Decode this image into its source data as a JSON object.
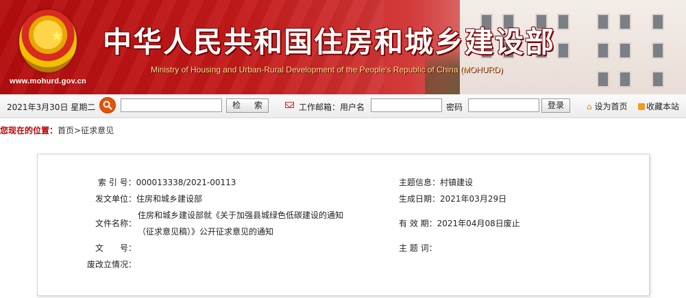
{
  "header": {
    "ministry_cn": "中华人民共和国住房和城乡建设部",
    "ministry_en": "Ministry of Housing and Urban-Rural Development of the People's Republic of China (MOHURD)",
    "site_url": "www.mohurd.gov.cn",
    "colors": {
      "banner_red": "#c41a1a",
      "title_white": "#ffffff",
      "english_yellow": "#ffe08a"
    }
  },
  "toolbar": {
    "date": "2021年3月30日 星期二",
    "search_placeholder": "",
    "search_label": "检 索",
    "mail_label": "工作邮箱：用户名",
    "password_label": "密码",
    "login_label": "登录",
    "home_label": "设为首页",
    "bookmark_label": "收藏本站",
    "icons": [
      "search-icon",
      "mail-icon",
      "home-icon",
      "rss-icon"
    ]
  },
  "breadcrumb": {
    "location_label": "您现在的位置：",
    "home": "首页",
    "separator": ">",
    "current": "征求意见"
  },
  "info": {
    "index_label": "索 引 号：",
    "index_value": "000013338/2021-00113",
    "topic_label": "主题信息：",
    "topic_value": "村镇建设",
    "issuer_label": "发文单位：",
    "issuer_value": "住房和城乡建设部",
    "date_label": "生成日期：",
    "date_value": "2021年03月29日",
    "title_label": "文件名称：",
    "title_line1": "住房和城乡建设部就《关于加强县城绿色低碳建设的通知",
    "title_line2": "（征求意见稿）》公开征求意见的通知",
    "validity_label": "有 效 期：",
    "validity_value": "2021年04月08日废止",
    "docno_label": "文　　号：",
    "docno_value": "",
    "keywords_label": "主 题 词：",
    "keywords_value": "",
    "status_label": "废改立情况：",
    "status_value": ""
  }
}
